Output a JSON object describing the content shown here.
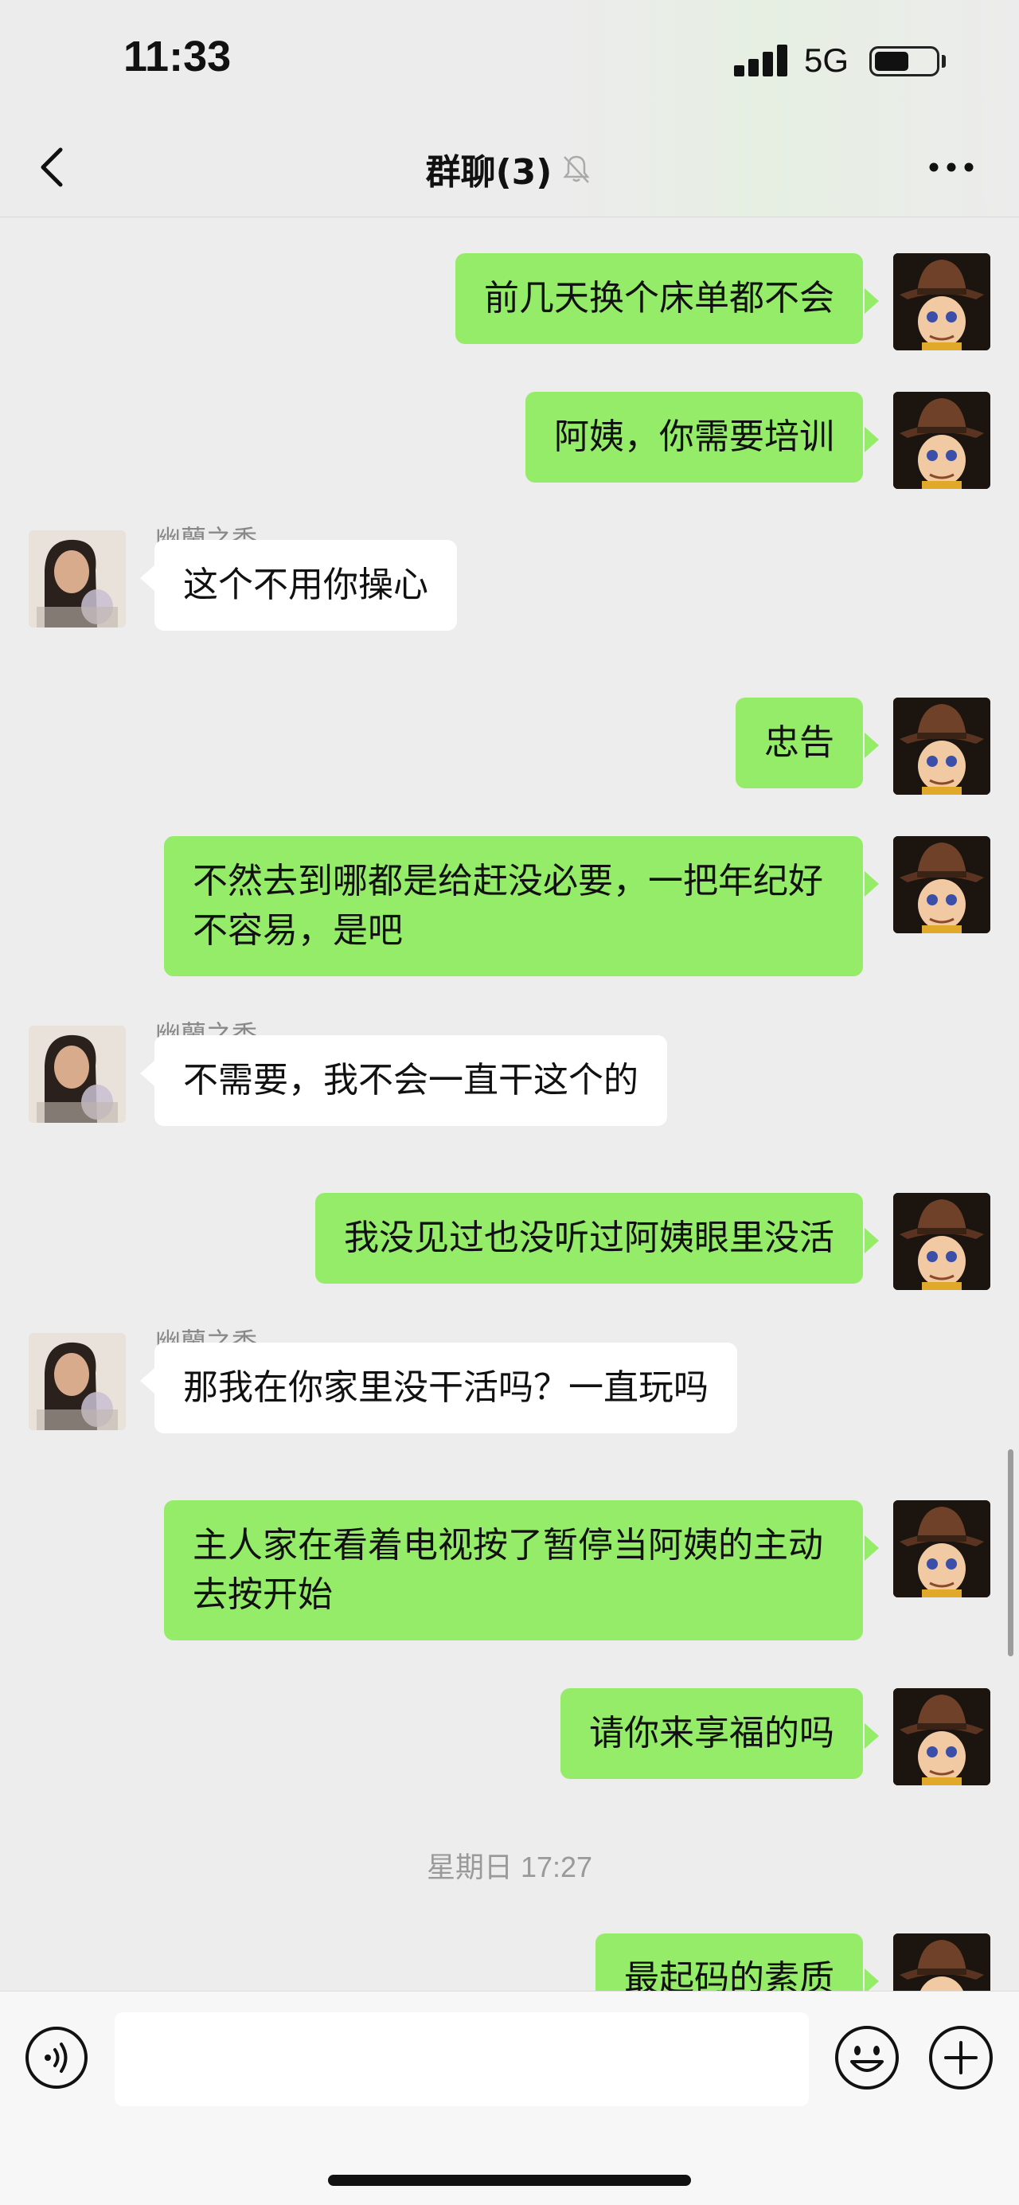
{
  "status_bar": {
    "time": "11:33",
    "network": "5G",
    "battery_level": 0.55
  },
  "nav": {
    "title": "群聊(3)",
    "back_icon": "chevron-left-icon",
    "mute_icon": "bell-off-icon",
    "more_icon": "ellipsis-icon"
  },
  "messages": [
    {
      "side": "right",
      "text": "前几天换个床单都不会"
    },
    {
      "side": "right",
      "text": "阿姨，你需要培训"
    },
    {
      "side": "left",
      "sender": "幽蘭之香",
      "text": "这个不用你操心"
    },
    {
      "side": "right",
      "text": "忠告"
    },
    {
      "side": "right",
      "text": "不然去到哪都是给赶没必要，一把年纪好不容易，是吧"
    },
    {
      "side": "left",
      "sender": "幽蘭之香",
      "text": "不需要，我不会一直干这个的"
    },
    {
      "side": "right",
      "text": "我没见过也没听过阿姨眼里没活"
    },
    {
      "side": "left",
      "sender": "幽蘭之香",
      "text": "那我在你家里没干活吗？一直玩吗"
    },
    {
      "side": "right",
      "text": "主人家在看着电视按了暂停当阿姨的主动去按开始"
    },
    {
      "side": "right",
      "text": "请你来享福的吗"
    },
    {
      "side": "right",
      "text": "最起码的素质"
    }
  ],
  "timestamp": "星期日 17:27",
  "input": {
    "placeholder": "",
    "voice_icon": "voice-icon",
    "emoji_icon": "emoji-icon",
    "plus_icon": "plus-icon"
  },
  "colors": {
    "bubble_self": "#95ec69",
    "bubble_other": "#ffffff",
    "background": "#ededed"
  }
}
